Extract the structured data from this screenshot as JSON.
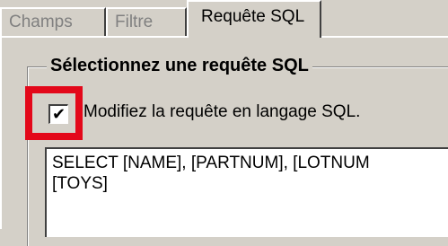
{
  "tabs": [
    {
      "label": "Champs",
      "active": false
    },
    {
      "label": "Filtre",
      "active": false
    },
    {
      "label": "Requête SQL",
      "active": true
    }
  ],
  "group": {
    "title": "Sélectionnez une requête SQL"
  },
  "checkbox": {
    "checked": true,
    "mark": "✔",
    "label": "Modifiez la requête en langage SQL."
  },
  "sql": {
    "value": "SELECT [NAME], [PARTNUM], [LOTNUM\n[TOYS]"
  },
  "colors": {
    "highlight": "#e3081a",
    "window": "#d4d0c8"
  }
}
